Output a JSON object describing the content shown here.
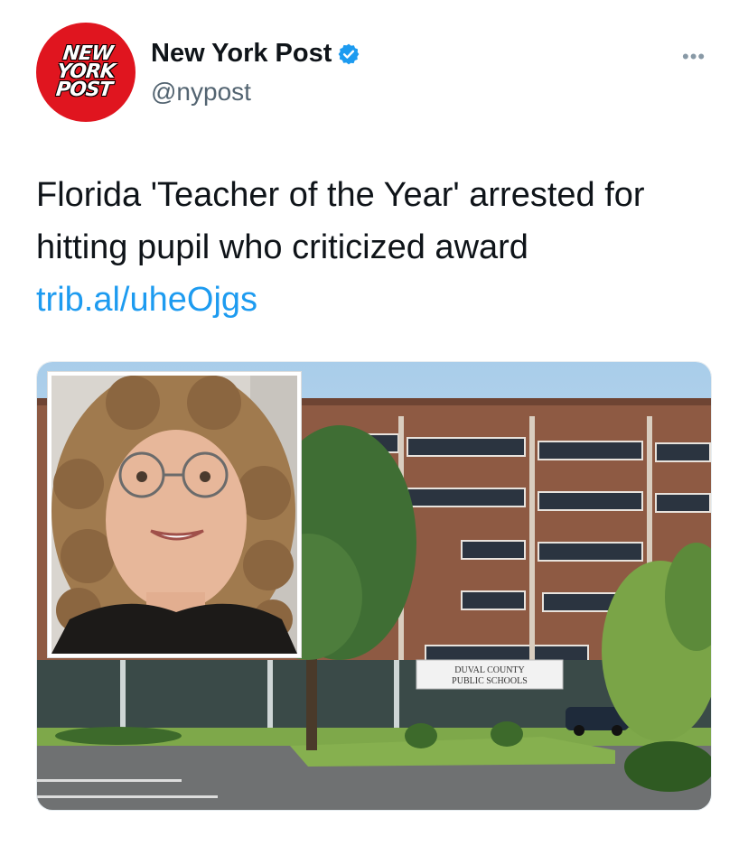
{
  "author": {
    "display_name": "New York Post",
    "handle": "@nypost",
    "logo_lines": [
      "NEW",
      "YORK",
      "POST"
    ],
    "verified_icon": "verified-badge-icon",
    "brand_color": "#e0151f"
  },
  "menu": {
    "more_label": "•••"
  },
  "tweet": {
    "text": "Florida 'Teacher of the Year' arrested for hitting pupil who criticized award",
    "link": "trib.al/uheOjgs",
    "link_color": "#1d9bf0"
  },
  "media": {
    "sign_line1": "DUVAL COUNTY",
    "sign_line2": "PUBLIC SCHOOLS"
  }
}
